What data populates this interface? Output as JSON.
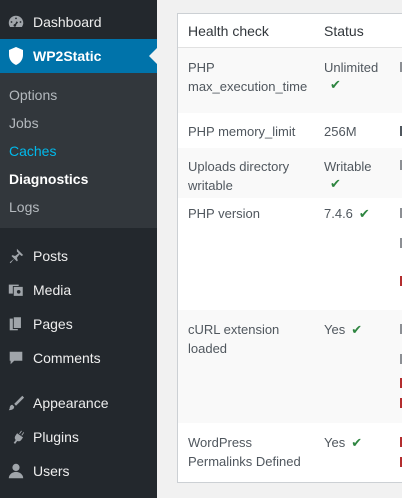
{
  "sidebar": {
    "items_top": [
      {
        "id": "dashboard",
        "label": "Dashboard",
        "icon": "dashboard-icon"
      },
      {
        "id": "wp2static",
        "label": "WP2Static",
        "icon": "shield-icon"
      }
    ],
    "submenu": [
      {
        "id": "options",
        "label": "Options",
        "state": "normal"
      },
      {
        "id": "jobs",
        "label": "Jobs",
        "state": "normal"
      },
      {
        "id": "caches",
        "label": "Caches",
        "state": "hover"
      },
      {
        "id": "diagnostics",
        "label": "Diagnostics",
        "state": "active"
      },
      {
        "id": "logs",
        "label": "Logs",
        "state": "normal"
      }
    ],
    "items_bottom": [
      {
        "id": "posts",
        "label": "Posts",
        "icon": "pushpin-icon"
      },
      {
        "id": "media",
        "label": "Media",
        "icon": "media-icon"
      },
      {
        "id": "pages",
        "label": "Pages",
        "icon": "pages-icon"
      },
      {
        "id": "comments",
        "label": "Comments",
        "icon": "comment-icon"
      },
      {
        "id": "appearance",
        "label": "Appearance",
        "icon": "paintbrush-icon"
      },
      {
        "id": "plugins",
        "label": "Plugins",
        "icon": "plugin-icon"
      },
      {
        "id": "users",
        "label": "Users",
        "icon": "user-icon"
      }
    ]
  },
  "table": {
    "headers": {
      "check": "Health check",
      "status": "Status"
    },
    "rows": [
      {
        "check": "PHP max_execution_time",
        "status": "Unlimited",
        "ok": true
      },
      {
        "check": "PHP memory_limit",
        "status": "256M",
        "ok": false
      },
      {
        "check": "Uploads directory writable",
        "status": "Writable",
        "ok": true
      },
      {
        "check": "PHP version",
        "status": "7.4.6",
        "ok": true
      },
      {
        "check": "cURL extension loaded",
        "status": "Yes",
        "ok": true
      },
      {
        "check": "WordPress Permalinks Defined",
        "status": "Yes",
        "ok": true
      }
    ],
    "tick_glyph": "✔"
  },
  "colors": {
    "sidebar_bg": "#23282d",
    "submenu_bg": "#32373c",
    "accent": "#0073aa",
    "hover": "#00b9eb",
    "ok": "#2e8540"
  }
}
